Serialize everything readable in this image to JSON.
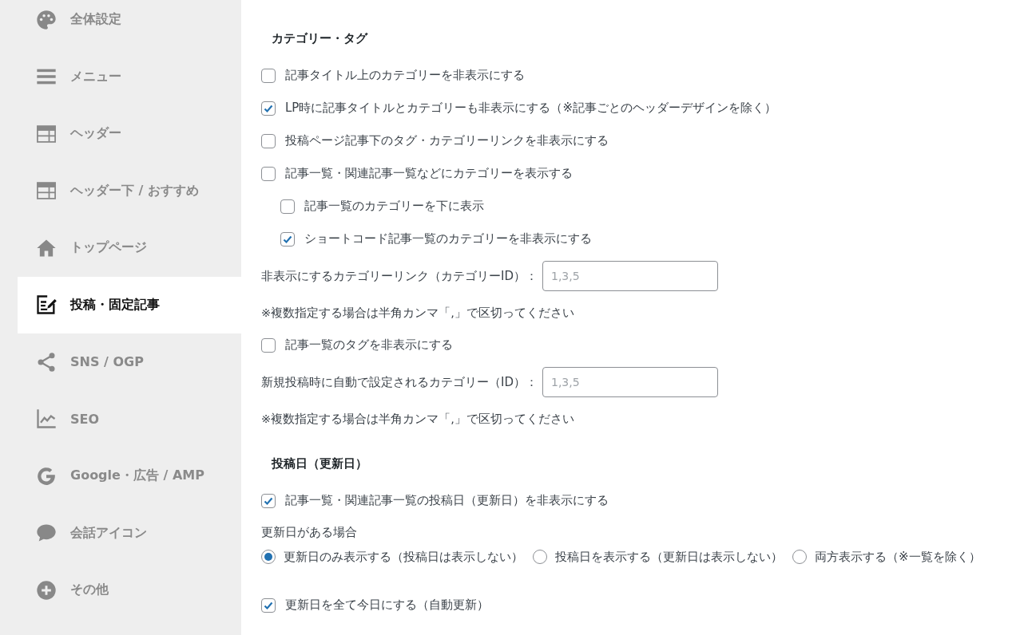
{
  "sidebar": {
    "items": [
      {
        "label": "全体設定",
        "selected": false
      },
      {
        "label": "メニュー",
        "selected": false
      },
      {
        "label": "ヘッダー",
        "selected": false
      },
      {
        "label": "ヘッダー下 / おすすめ",
        "selected": false
      },
      {
        "label": "トップページ",
        "selected": false
      },
      {
        "label": "投稿・固定記事",
        "selected": true
      },
      {
        "label": "SNS / OGP",
        "selected": false
      },
      {
        "label": "SEO",
        "selected": false
      },
      {
        "label": "Google・広告 / AMP",
        "selected": false
      },
      {
        "label": "会話アイコン",
        "selected": false
      },
      {
        "label": "その他",
        "selected": false
      }
    ]
  },
  "sections": [
    {
      "title": "カテゴリー・タグ",
      "rows": [
        {
          "kind": "checkbox",
          "label": "記事タイトル上のカテゴリーを非表示にする",
          "checked": false
        },
        {
          "kind": "checkbox",
          "label": "LP時に記事タイトルとカテゴリーも非表示にする（※記事ごとのヘッダーデザインを除く）",
          "checked": true
        },
        {
          "kind": "checkbox",
          "label": "投稿ページ記事下のタグ・カテゴリーリンクを非表示にする",
          "checked": false
        },
        {
          "kind": "checkbox",
          "label": "記事一覧・関連記事一覧などにカテゴリーを表示する",
          "checked": false,
          "children": [
            {
              "label": "記事一覧のカテゴリーを下に表示",
              "checked": false
            },
            {
              "label": "ショートコード記事一覧のカテゴリーを非表示にする",
              "checked": true
            }
          ]
        },
        {
          "kind": "input",
          "label": "非表示にするカテゴリーリンク（カテゴリーID）：",
          "placeholder": "1,3,5"
        },
        {
          "kind": "note",
          "label": "※複数指定する場合は半角カンマ「,」で区切ってください"
        },
        {
          "kind": "checkbox",
          "label": "記事一覧のタグを非表示にする",
          "checked": false
        },
        {
          "kind": "input",
          "label": "新規投稿時に自動で設定されるカテゴリー（ID）：",
          "placeholder": "1,3,5"
        },
        {
          "kind": "note",
          "label": "※複数指定する場合は半角カンマ「,」で区切ってください"
        }
      ]
    },
    {
      "title": "投稿日（更新日）",
      "rows": [
        {
          "kind": "checkbox",
          "label": "記事一覧・関連記事一覧の投稿日（更新日）を非表示にする",
          "checked": true
        },
        {
          "kind": "radios",
          "label": "更新日がある場合",
          "options": [
            {
              "label": "更新日のみ表示する（投稿日は表示しない）",
              "selected": true
            },
            {
              "label": "投稿日を表示する（更新日は表示しない）",
              "selected": false
            },
            {
              "label": "両方表示する（※一覧を除く）",
              "selected": false
            }
          ]
        },
        {
          "kind": "checkbox",
          "label": "更新日を全て今日にする（自動更新）",
          "checked": true
        }
      ]
    }
  ]
}
